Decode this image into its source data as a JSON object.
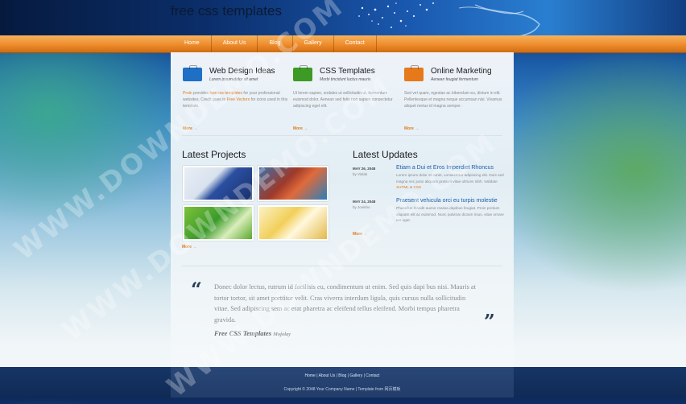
{
  "site": {
    "title": "free css templates"
  },
  "nav": [
    "Home",
    "About Us",
    "Blog",
    "Gallery",
    "Contact"
  ],
  "features": [
    {
      "icon": "briefcase-blue-icon",
      "color": "#1f6fc4",
      "title": "Web Design Ideas",
      "subtitle": "Lorem ipsum dolor sit amet",
      "body_parts": [
        "",
        "Proin",
        " provides ",
        "free css templates",
        " for your professional websites. Credit goes to ",
        "Free Vectors",
        " for icons used in this template."
      ],
      "more": "More →"
    },
    {
      "icon": "briefcase-green-icon",
      "color": "#3d9a24",
      "title": "CSS Templates",
      "subtitle": "Morbi tincidunt luctus mauris",
      "body": "Ut lorem sapien, sodales ut sollicitudin ut, fermentum euismod dolor. Aenean sed felis non sapien consectetur adipiscing eget elit.",
      "more": "More →"
    },
    {
      "icon": "briefcase-orange-icon",
      "color": "#e67a1a",
      "title": "Online Marketing",
      "subtitle": "Aenean feugiat fermentum",
      "body": "Sed vel quam, egestas ac bibendum eu, dictum in elit. Pellentesque et magna neque accumsan nisi. Vivamus aliquet metus id magna semper.",
      "more": "More →"
    }
  ],
  "projects": {
    "title": "Latest Projects",
    "more": "More →"
  },
  "updates": {
    "title": "Latest Updates",
    "items": [
      {
        "date": "MAY 26, 2048",
        "by": "by Vinlak",
        "title": "Etiam a Dui et Eros Imperdiet Rhoncus",
        "body": "Lorem ipsum dolor sit amet, consectetur adipiscing elit. Duis sed magna nec justo aliquam pretium vitae ultrices nibh. Validate",
        "links": [
          "XHTML",
          "CSS"
        ]
      },
      {
        "date": "MAY 24, 2048",
        "by": "by Jovinho",
        "title": "Praesent vehicula orci eu turpis molestie",
        "body": "Phasellus blandit auctor massa dapibus feugiat. Proin pretium aliquam elit ac euismod. Nunc pulvinar dictum risus, vitae ornare est eget."
      }
    ],
    "more": "More →"
  },
  "quote": {
    "text": "Donec dolor lectus, rutrum id facilisis eu, condimentum ut enim. Sed quis dapi bus nisi. Mauris at tortor tortor, sit amet porttitor velit. Cras viverra interdum ligula, quis cursus nulla sollicitudin vitae. Sed adipiscing sem ac erat pharetra ac eleifend tellus eleifend. Morbi tempus pharetra gravida.",
    "source": "Free CSS Templates",
    "author": "Mojolay",
    "open_mark": "“",
    "close_mark": "”"
  },
  "footer": {
    "links": "Home | About Us | Blog | Gallery | Contact",
    "copyright": "Copyright © 2048 Your Company Name | Template from 网页模板"
  },
  "watermark": "WWW.DOWNDEMO.COM"
}
